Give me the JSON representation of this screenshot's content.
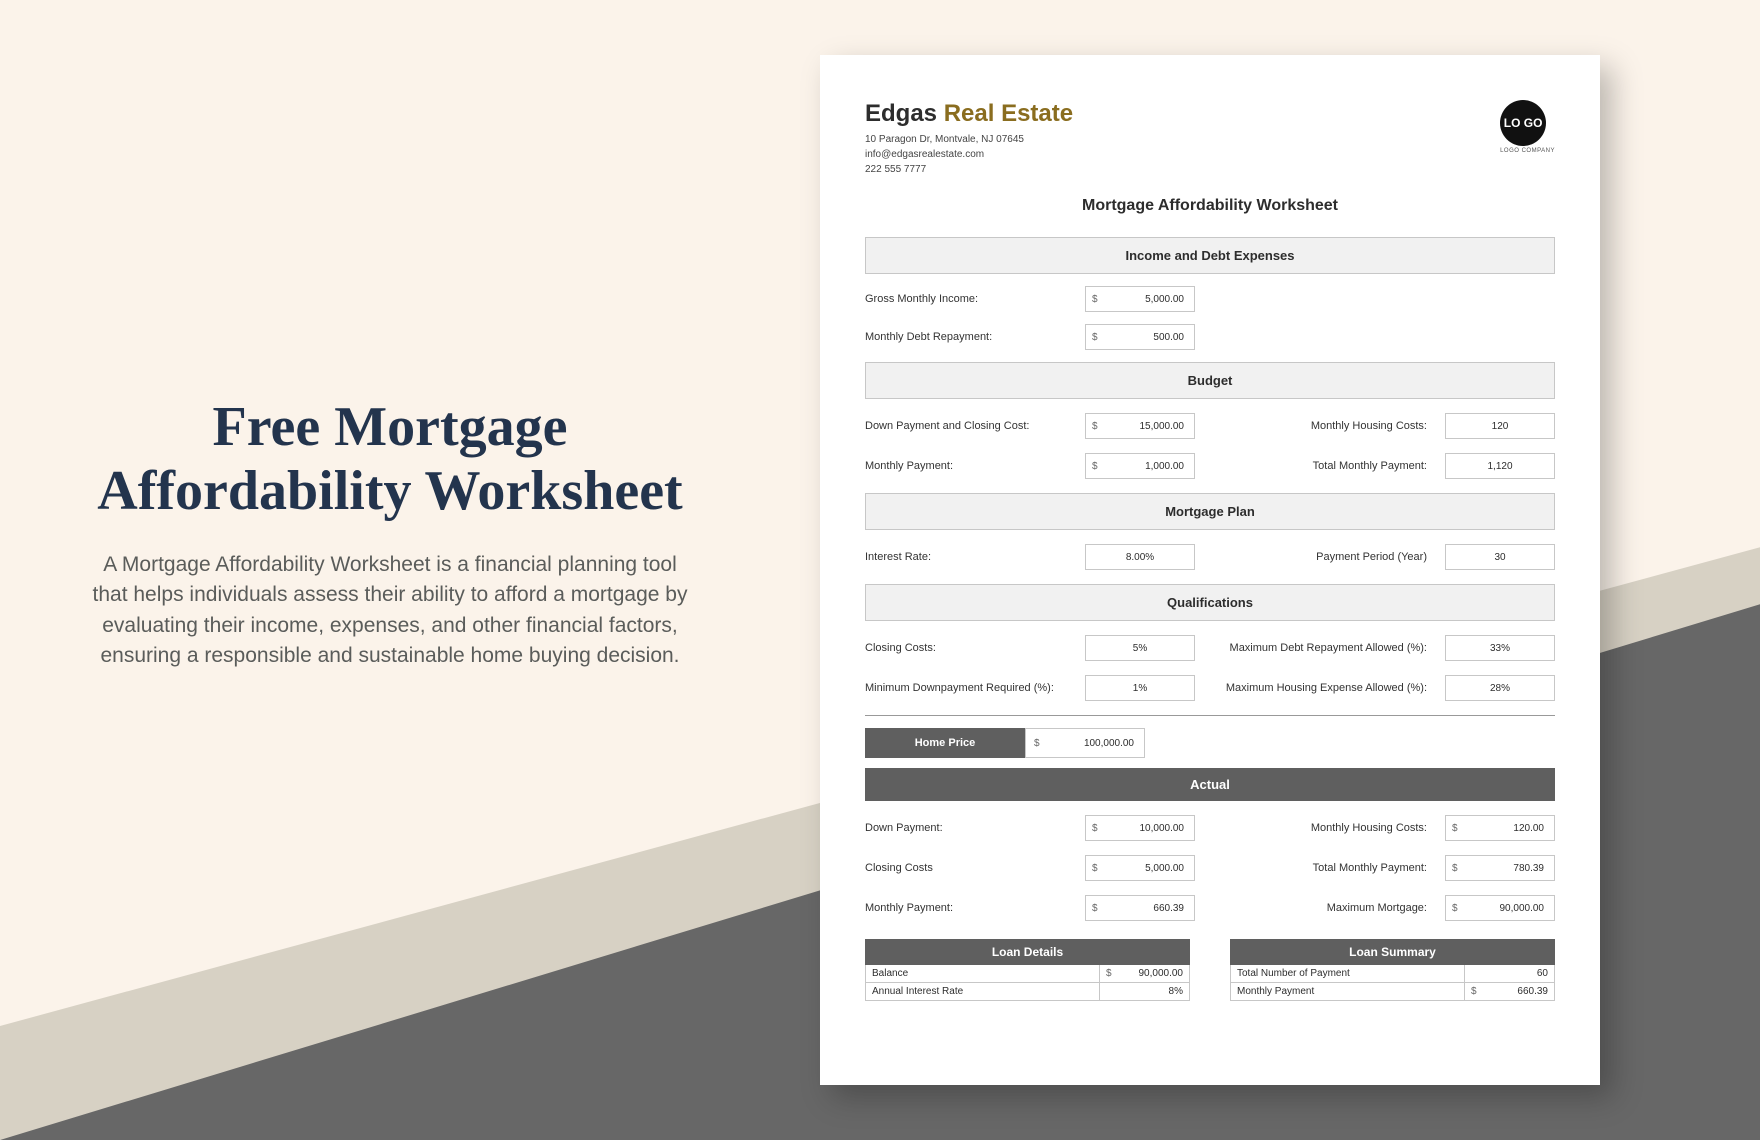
{
  "hero": {
    "title": "Free Mortgage Affordability Worksheet",
    "description": "A Mortgage Affordability Worksheet is a financial planning tool that helps individuals assess their ability to afford a mortgage by evaluating their income, expenses, and other financial factors, ensuring a responsible and sustainable home buying decision."
  },
  "company": {
    "name_a": "Edgas",
    "name_b": "Real Estate",
    "address": "10 Paragon Dr, Montvale, NJ 07645",
    "email": "info@edgasrealestate.com",
    "phone": "222 555 7777",
    "logo_text": "LO GO",
    "logo_caption": "LOGO COMPANY"
  },
  "worksheet": {
    "title": "Mortgage Affordability Worksheet",
    "sections": {
      "income": {
        "header": "Income and Debt Expenses",
        "gross_label": "Gross Monthly Income:",
        "gross_value": "5,000.00",
        "debt_label": "Monthly Debt Repayment:",
        "debt_value": "500.00"
      },
      "budget": {
        "header": "Budget",
        "down_label": "Down Payment and Closing Cost:",
        "down_value": "15,000.00",
        "housing_label": "Monthly Housing Costs:",
        "housing_value": "120",
        "monthly_pay_label": "Monthly Payment:",
        "monthly_pay_value": "1,000.00",
        "total_pay_label": "Total Monthly Payment:",
        "total_pay_value": "1,120"
      },
      "plan": {
        "header": "Mortgage Plan",
        "rate_label": "Interest Rate:",
        "rate_value": "8.00%",
        "period_label": "Payment Period (Year)",
        "period_value": "30"
      },
      "qual": {
        "header": "Qualifications",
        "closing_label": "Closing Costs:",
        "closing_value": "5%",
        "maxdebt_label": "Maximum Debt Repayment Allowed (%):",
        "maxdebt_value": "33%",
        "mindown_label": "Minimum Downpayment Required (%):",
        "mindown_value": "1%",
        "maxhouse_label": "Maximum Housing Expense Allowed (%):",
        "maxhouse_value": "28%"
      },
      "home": {
        "label": "Home Price",
        "value": "100,000.00"
      },
      "actual": {
        "header": "Actual",
        "down_label": "Down Payment:",
        "down_value": "10,000.00",
        "housing_label": "Monthly Housing Costs:",
        "housing_value": "120.00",
        "closing_label": "Closing Costs",
        "closing_value": "5,000.00",
        "total_label": "Total Monthly Payment:",
        "total_value": "780.39",
        "monthly_label": "Monthly Payment:",
        "monthly_value": "660.39",
        "max_label": "Maximum Mortgage:",
        "max_value": "90,000.00"
      },
      "loan_details": {
        "header": "Loan Details",
        "balance_label": "Balance",
        "balance_value": "90,000.00",
        "air_label": "Annual Interest Rate",
        "air_value": "8%"
      },
      "loan_summary": {
        "header": "Loan Summary",
        "num_label": "Total Number of Payment",
        "num_value": "60",
        "mp_label": "Monthly Payment",
        "mp_value": "660.39"
      }
    }
  }
}
